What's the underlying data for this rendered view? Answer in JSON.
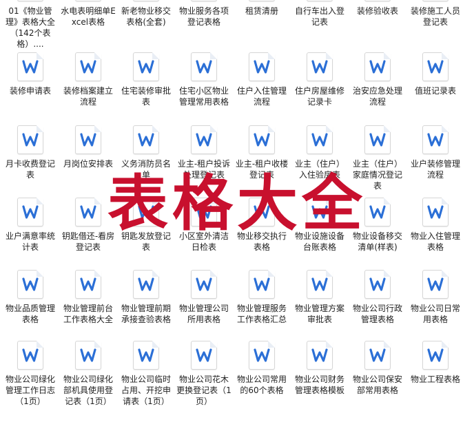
{
  "overlay_text": "表格大全",
  "colors": {
    "word_blue": "#2b6fd6",
    "overlay_red": "#c8102e"
  },
  "files": [
    {
      "label": "01《物业管理》表格大全（142个表格）....",
      "icon": "folder-word-icon"
    },
    {
      "label": "水电表明细单Excel表格",
      "icon": "word-doc-icon"
    },
    {
      "label": "新老物业移交表格(全套)",
      "icon": "word-doc-icon"
    },
    {
      "label": "物业服务各项登记表格",
      "icon": "word-doc-icon"
    },
    {
      "label": "租赁清册",
      "icon": "word-doc-icon"
    },
    {
      "label": "自行车出入登记表",
      "icon": "word-doc-icon"
    },
    {
      "label": "装修验收表",
      "icon": "word-doc-icon"
    },
    {
      "label": "装修施工人员登记表",
      "icon": "word-doc-icon"
    },
    {
      "label": "装修申请表",
      "icon": "word-doc-icon"
    },
    {
      "label": "装修档案建立流程",
      "icon": "word-doc-icon"
    },
    {
      "label": "住宅装修审批表",
      "icon": "word-doc-icon"
    },
    {
      "label": "住宅小区物业管理常用表格",
      "icon": "word-doc-icon"
    },
    {
      "label": "住户入住管理流程",
      "icon": "word-doc-icon"
    },
    {
      "label": "住户房屋维修记录卡",
      "icon": "word-doc-icon"
    },
    {
      "label": "治安应急处理流程",
      "icon": "word-doc-icon"
    },
    {
      "label": "值班记录表",
      "icon": "word-doc-icon"
    },
    {
      "label": "月卡收费登记表",
      "icon": "word-doc-icon"
    },
    {
      "label": "月岗位安排表",
      "icon": "word-doc-icon"
    },
    {
      "label": "义务消防员名单",
      "icon": "word-doc-icon"
    },
    {
      "label": "业主-租户投诉处理登记表",
      "icon": "word-doc-icon"
    },
    {
      "label": "业主-租户收楼登记表",
      "icon": "word-doc-icon"
    },
    {
      "label": "业主（住户）入住验房表",
      "icon": "word-doc-icon"
    },
    {
      "label": "业主（住户）家庭情况登记表",
      "icon": "word-doc-icon"
    },
    {
      "label": "业户装修管理流程",
      "icon": "word-doc-icon"
    },
    {
      "label": "业户满意率统计表",
      "icon": "word-doc-icon"
    },
    {
      "label": "钥匙借还-看房登记表",
      "icon": "word-doc-icon"
    },
    {
      "label": "钥匙发放登记表",
      "icon": "word-doc-icon"
    },
    {
      "label": "小区室外清洁日检表",
      "icon": "word-doc-icon"
    },
    {
      "label": "物业移交执行表格",
      "icon": "word-doc-icon"
    },
    {
      "label": "物业设施设备台账表格",
      "icon": "word-doc-icon"
    },
    {
      "label": "物业设备移交清单(样表)",
      "icon": "word-doc-icon"
    },
    {
      "label": "物业入住管理表格",
      "icon": "word-doc-icon"
    },
    {
      "label": "物业品质管理表格",
      "icon": "word-doc-icon"
    },
    {
      "label": "物业管理前台工作表格大全",
      "icon": "word-doc-icon"
    },
    {
      "label": "物业管理前期承接查验表格",
      "icon": "word-doc-icon"
    },
    {
      "label": "物业管理公司所用表格",
      "icon": "word-doc-icon"
    },
    {
      "label": "物业管理服务工作表格汇总",
      "icon": "word-doc-icon"
    },
    {
      "label": "物业管理方案审批表",
      "icon": "word-doc-icon"
    },
    {
      "label": "物业公司行政管理表格",
      "icon": "word-doc-icon"
    },
    {
      "label": "物业公司日常用表格",
      "icon": "word-doc-icon"
    },
    {
      "label": "物业公司绿化管理工作日志（1页）",
      "icon": "word-doc-icon"
    },
    {
      "label": "物业公司绿化部机具使用登记表（1页）",
      "icon": "word-doc-icon"
    },
    {
      "label": "物业公司临时占用、开挖申请表（1页）",
      "icon": "word-doc-icon"
    },
    {
      "label": "物业公司花木更换登记表（1页）",
      "icon": "word-doc-icon"
    },
    {
      "label": "物业公司常用的60个表格",
      "icon": "word-doc-icon"
    },
    {
      "label": "物业公司财务管理表格模板",
      "icon": "word-doc-icon"
    },
    {
      "label": "物业公司保安部常用表格",
      "icon": "word-doc-icon"
    },
    {
      "label": "物业工程表格",
      "icon": "word-doc-icon"
    }
  ]
}
